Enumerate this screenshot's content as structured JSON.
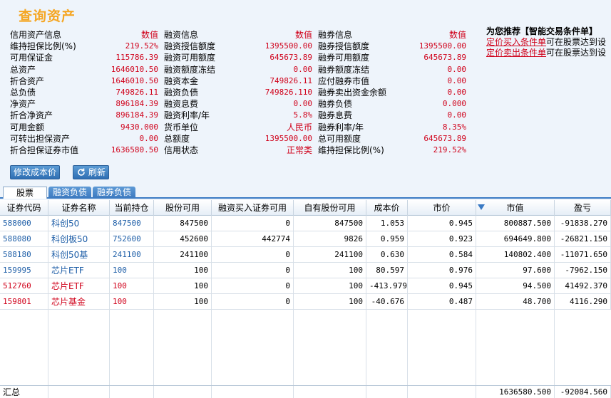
{
  "page_title": "查询资产",
  "credit_assets": {
    "header": "信用资产信息",
    "value_header": "数值",
    "rows": [
      {
        "label": "维持担保比例(%)",
        "value": "219.52%"
      },
      {
        "label": "可用保证金",
        "value": "115786.39"
      },
      {
        "label": "总资产",
        "value": "1646010.50"
      },
      {
        "label": "折合资产",
        "value": "1646010.50"
      },
      {
        "label": "总负债",
        "value": "749826.11"
      },
      {
        "label": "净资产",
        "value": "896184.39"
      },
      {
        "label": "折合净资产",
        "value": "896184.39"
      },
      {
        "label": "可用金额",
        "value": "9430.000"
      },
      {
        "label": "可转出担保资产",
        "value": "0.00"
      },
      {
        "label": "折合担保证券市值",
        "value": "1636580.50"
      }
    ]
  },
  "margin_info": {
    "header": "融资信息",
    "value_header": "数值",
    "rows": [
      {
        "label": "融资授信额度",
        "value": "1395500.00"
      },
      {
        "label": "融资可用额度",
        "value": "645673.89"
      },
      {
        "label": "融资额度冻结",
        "value": "0.00"
      },
      {
        "label": "融资本金",
        "value": "749826.11"
      },
      {
        "label": "融资负债",
        "value": "749826.110"
      },
      {
        "label": "融资息费",
        "value": "0.00"
      },
      {
        "label": "融资利率/年",
        "value": "5.8%"
      },
      {
        "label": "货币单位",
        "value": "人民币"
      },
      {
        "label": "总额度",
        "value": "1395500.00"
      },
      {
        "label": "信用状态",
        "value": "正常类"
      }
    ]
  },
  "short_info": {
    "header": "融券信息",
    "value_header": "数值",
    "rows": [
      {
        "label": "融券授信额度",
        "value": "1395500.00"
      },
      {
        "label": "融券可用额度",
        "value": "645673.89"
      },
      {
        "label": "融券额度冻结",
        "value": "0.00"
      },
      {
        "label": "应付融券市值",
        "value": "0.00"
      },
      {
        "label": "融券卖出资金余额",
        "value": "0.00"
      },
      {
        "label": "融券负债",
        "value": "0.000"
      },
      {
        "label": "融券息费",
        "value": "0.00"
      },
      {
        "label": "融券利率/年",
        "value": "8.35%"
      },
      {
        "label": "总可用额度",
        "value": "645673.89"
      },
      {
        "label": "维持担保比例(%)",
        "value": "219.52%"
      }
    ]
  },
  "recommend": {
    "title": "为您推荐【智能交易条件单】",
    "line1_link": "定价买入条件单",
    "line1_text": "可在股票达到设",
    "line2_link": "定价卖出条件单",
    "line2_text": "可在股票达到设"
  },
  "buttons": {
    "modify_cost": "修改成本价",
    "refresh": "刷新"
  },
  "tabs": [
    "股票",
    "融资负债",
    "融券负债"
  ],
  "table": {
    "columns": [
      "证券代码",
      "证券名称",
      "当前持仓",
      "股份可用",
      "融资买入证券可用",
      "自有股份可用",
      "成本价",
      "市价",
      "市值",
      "盈亏"
    ],
    "rows": [
      {
        "code": "588000",
        "name": "科创50",
        "hold": "847500",
        "avail": "847500",
        "margin_avail": "0",
        "own_avail": "847500",
        "cost": "1.053",
        "price": "0.945",
        "mv": "800887.500",
        "pl": "-91838.270",
        "color": "blue"
      },
      {
        "code": "588080",
        "name": "科创板50",
        "hold": "752600",
        "avail": "452600",
        "margin_avail": "442774",
        "own_avail": "9826",
        "cost": "0.959",
        "price": "0.923",
        "mv": "694649.800",
        "pl": "-26821.150",
        "color": "blue"
      },
      {
        "code": "588180",
        "name": "科创50基",
        "hold": "241100",
        "avail": "241100",
        "margin_avail": "0",
        "own_avail": "241100",
        "cost": "0.630",
        "price": "0.584",
        "mv": "140802.400",
        "pl": "-11071.650",
        "color": "blue"
      },
      {
        "code": "159995",
        "name": "芯片ETF",
        "hold": "100",
        "avail": "100",
        "margin_avail": "0",
        "own_avail": "100",
        "cost": "80.597",
        "price": "0.976",
        "mv": "97.600",
        "pl": "-7962.150",
        "color": "blue"
      },
      {
        "code": "512760",
        "name": "芯片ETF",
        "hold": "100",
        "avail": "100",
        "margin_avail": "0",
        "own_avail": "100",
        "cost": "-413.979",
        "price": "0.945",
        "mv": "94.500",
        "pl": "41492.370",
        "color": "red"
      },
      {
        "code": "159801",
        "name": "芯片基金",
        "hold": "100",
        "avail": "100",
        "margin_avail": "0",
        "own_avail": "100",
        "cost": "-40.676",
        "price": "0.487",
        "mv": "48.700",
        "pl": "4116.290",
        "color": "red"
      }
    ],
    "summary": {
      "label": "汇总",
      "mv": "1636580.500",
      "pl": "-92084.560"
    }
  },
  "colors": {
    "accent": "#f5a623",
    "value_red": "#d0021b",
    "code_blue": "#1f5fa8"
  }
}
